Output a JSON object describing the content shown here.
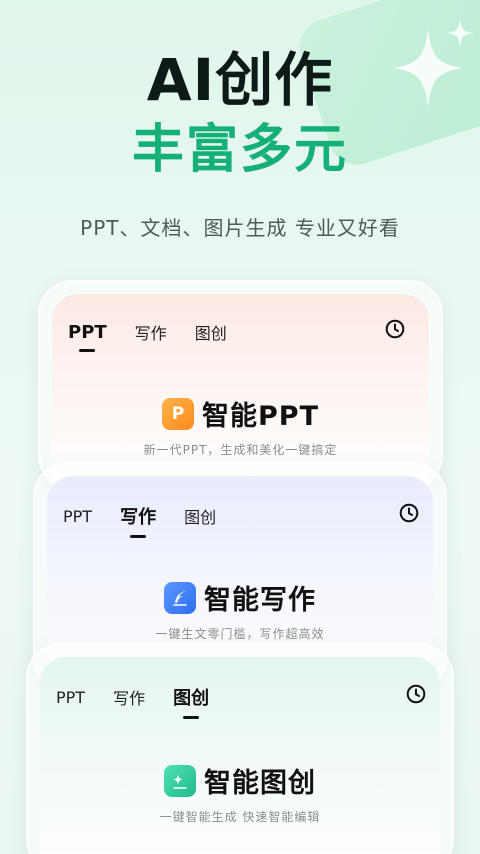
{
  "hero": {
    "title": "AI创作",
    "subtitle": "丰富多元",
    "description": "PPT、文档、图片生成 专业又好看"
  },
  "cards": [
    {
      "tabs": [
        "PPT",
        "写作",
        "图创"
      ],
      "active_tab": 0,
      "feature_icon_label": "P",
      "feature_icon": "ppt-icon",
      "feature_icon_color": "#ff9a2e",
      "feature_title": "智能PPT",
      "feature_desc": "新一代PPT，生成和美化一键搞定"
    },
    {
      "tabs": [
        "PPT",
        "写作",
        "图创"
      ],
      "active_tab": 1,
      "feature_icon": "writing-feather-icon",
      "feature_icon_color": "#3b7bf6",
      "feature_title": "智能写作",
      "feature_desc": "一键生文零门槛，写作超高效"
    },
    {
      "tabs": [
        "PPT",
        "写作",
        "图创"
      ],
      "active_tab": 2,
      "feature_icon": "image-sparkle-icon",
      "feature_icon_color": "#2fc79a",
      "feature_title": "智能图创",
      "feature_desc": "一键智能生成 快速智能编辑"
    }
  ],
  "icons": {
    "history": "clock-icon",
    "decoration": "sparkle-icon"
  },
  "colors": {
    "accent_green": "#14b077",
    "title_dark": "#0e1a17"
  }
}
